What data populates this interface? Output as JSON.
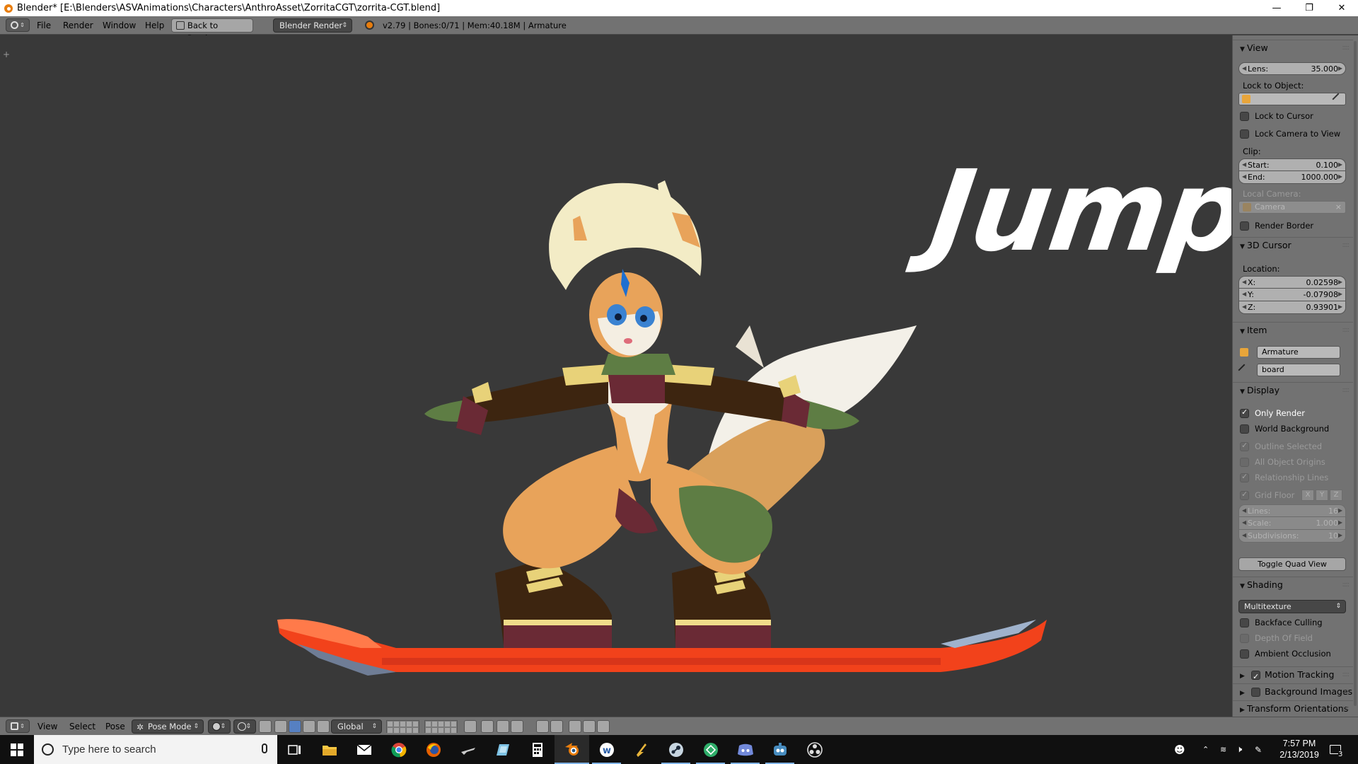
{
  "window": {
    "title": "Blender* [E:\\Blenders\\ASVAnimations\\Characters\\AnthroAsset\\ZorritaCGT\\zorrita-CGT.blend]",
    "controls": [
      "minimize",
      "restore",
      "close"
    ]
  },
  "info_header": {
    "menus": [
      "File",
      "Render",
      "Window",
      "Help"
    ],
    "back_button": "Back to Previous",
    "render_engine": "Blender Render",
    "stats": "v2.79 | Bones:0/71 | Mem:40.18M | Armature"
  },
  "viewport": {
    "overlay_text": "Jump"
  },
  "properties": {
    "view": {
      "header": "View",
      "lens_label": "Lens:",
      "lens_value": "35.000",
      "lock_to_object_label": "Lock to Object:",
      "lock_to_cursor": "Lock to Cursor",
      "lock_camera_to_view": "Lock Camera to View",
      "clip_label": "Clip:",
      "clip_start_label": "Start:",
      "clip_start": "0.100",
      "clip_end_label": "End:",
      "clip_end": "1000.000",
      "local_camera_label": "Local Camera:",
      "local_camera_value": "Camera",
      "render_border": "Render Border"
    },
    "cursor": {
      "header": "3D Cursor",
      "location_label": "Location:",
      "x_label": "X:",
      "x": "0.02598",
      "y_label": "Y:",
      "y": "-0.07908",
      "z_label": "Z:",
      "z": "0.93901"
    },
    "item": {
      "header": "Item",
      "object_name": "Armature",
      "bone_name": "board"
    },
    "display": {
      "header": "Display",
      "only_render": "Only Render",
      "world_background": "World Background",
      "outline_selected": "Outline Selected",
      "all_object_origins": "All Object Origins",
      "relationship_lines": "Relationship Lines",
      "grid_floor": "Grid Floor",
      "grid_axes": [
        "X",
        "Y",
        "Z"
      ],
      "lines_label": "Lines:",
      "lines": "16",
      "scale_label": "Scale:",
      "scale": "1.000",
      "subdivisions_label": "Subdivisions:",
      "subdivisions": "10",
      "toggle_quad_view": "Toggle Quad View"
    },
    "shading": {
      "header": "Shading",
      "mode": "Multitexture",
      "backface_culling": "Backface Culling",
      "depth_of_field": "Depth Of Field",
      "ambient_occlusion": "Ambient Occlusion"
    },
    "collapsed_panels": [
      "Motion Tracking",
      "Background Images",
      "Transform Orientations"
    ]
  },
  "viewport_footer": {
    "menus": [
      "View",
      "Select",
      "Pose"
    ],
    "mode": "Pose Mode",
    "orientation": "Global"
  },
  "taskbar": {
    "search_placeholder": "Type here to search",
    "time": "7:57 PM",
    "date": "2/13/2019",
    "notification_count": "3"
  },
  "colors": {
    "ui_gray": "#727272",
    "viewport_bg": "#393939",
    "board_red": "#f2421b",
    "taskbar_bg": "#101010",
    "blender_orange": "#e87d0d"
  }
}
